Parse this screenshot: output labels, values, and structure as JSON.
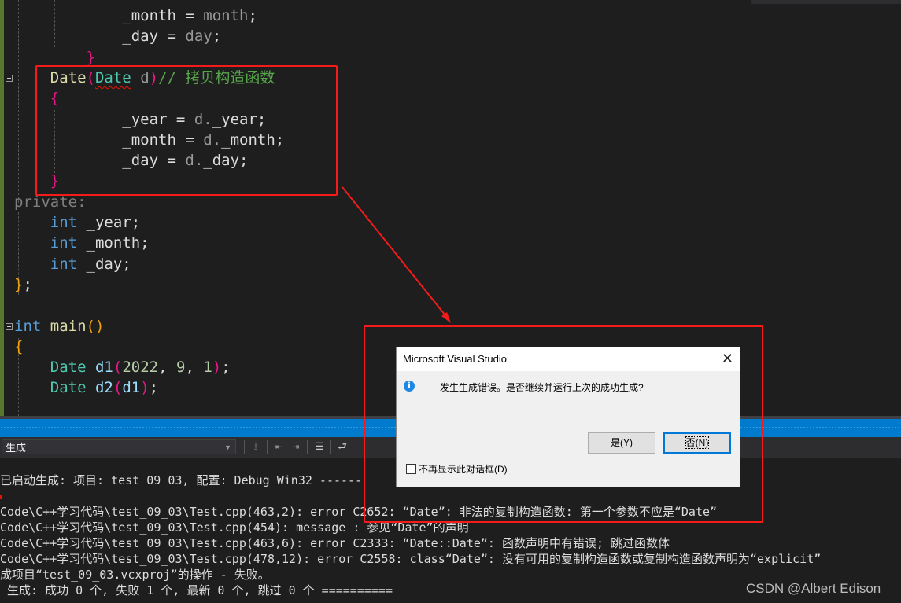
{
  "colors": {
    "accent": "#007acc",
    "annotation": "#f51b1b",
    "error_squiggle": "#e51400"
  },
  "editor": {
    "lines": [
      [
        [
          "            ",
          ""
        ],
        [
          "_month",
          "id"
        ],
        [
          " = ",
          "id"
        ],
        [
          "month",
          "pr"
        ],
        [
          ";",
          "id"
        ]
      ],
      [
        [
          "            ",
          ""
        ],
        [
          "_day",
          "id"
        ],
        [
          " = ",
          "id"
        ],
        [
          "day",
          "pr"
        ],
        [
          ";",
          "id"
        ]
      ],
      [
        [
          "        ",
          ""
        ],
        [
          "}",
          "br1"
        ]
      ],
      [
        [
          "    ",
          ""
        ],
        [
          "Date",
          "fn"
        ],
        [
          "(",
          "br1"
        ],
        [
          "Date",
          "ty sq"
        ],
        [
          " ",
          ""
        ],
        [
          "d",
          "pr"
        ],
        [
          ")",
          "br1"
        ],
        [
          "// 拷贝构造函数",
          "cm"
        ]
      ],
      [
        [
          "    ",
          ""
        ],
        [
          "{",
          "br1"
        ]
      ],
      [
        [
          "            ",
          ""
        ],
        [
          "_year",
          "id"
        ],
        [
          " = ",
          "id"
        ],
        [
          "d.",
          "pr"
        ],
        [
          "_year",
          "id"
        ],
        [
          ";",
          "id"
        ]
      ],
      [
        [
          "            ",
          ""
        ],
        [
          "_month",
          "id"
        ],
        [
          " = ",
          "id"
        ],
        [
          "d.",
          "pr"
        ],
        [
          "_month",
          "id"
        ],
        [
          ";",
          "id"
        ]
      ],
      [
        [
          "            ",
          ""
        ],
        [
          "_day",
          "id"
        ],
        [
          " = ",
          "id"
        ],
        [
          "d.",
          "pr"
        ],
        [
          "_day",
          "id"
        ],
        [
          ";",
          "id"
        ]
      ],
      [
        [
          "    ",
          ""
        ],
        [
          "}",
          "br1"
        ]
      ],
      [
        [
          "private:",
          "pv"
        ]
      ],
      [
        [
          "    ",
          ""
        ],
        [
          "int",
          "kw"
        ],
        [
          " _year;",
          "id"
        ]
      ],
      [
        [
          "    ",
          ""
        ],
        [
          "int",
          "kw"
        ],
        [
          " _month;",
          "id"
        ]
      ],
      [
        [
          "    ",
          ""
        ],
        [
          "int",
          "kw"
        ],
        [
          " _day;",
          "id"
        ]
      ],
      [
        [
          "}",
          "br2"
        ],
        [
          ";",
          "id"
        ]
      ],
      [
        [
          "",
          ""
        ]
      ],
      [
        [
          "int",
          "kw"
        ],
        [
          " ",
          ""
        ],
        [
          "main",
          "fn"
        ],
        [
          "()",
          "br2"
        ]
      ],
      [
        [
          "{",
          "br2"
        ]
      ],
      [
        [
          "    ",
          ""
        ],
        [
          "Date",
          "ty"
        ],
        [
          " ",
          ""
        ],
        [
          "d1",
          "lv"
        ],
        [
          "(",
          "br1"
        ],
        [
          "2022",
          "nm"
        ],
        [
          ", ",
          ""
        ],
        [
          "9",
          "nm"
        ],
        [
          ", ",
          ""
        ],
        [
          "1",
          "nm"
        ],
        [
          ")",
          "br1"
        ],
        [
          ";",
          "id"
        ]
      ],
      [
        [
          "    ",
          ""
        ],
        [
          "Date",
          "ty"
        ],
        [
          " ",
          ""
        ],
        [
          "d2",
          "lv"
        ],
        [
          "(",
          "br1"
        ],
        [
          "d1",
          "lv"
        ],
        [
          ")",
          "br1"
        ],
        [
          ";",
          "id"
        ]
      ]
    ]
  },
  "output_panel": {
    "source_label": "生成",
    "lines": [
      "已启动生成: 项目: test_09_03, 配置: Debug Win32 ------",
      "",
      "Code\\C++学习代码\\test_09_03\\Test.cpp(463,2): error C2652: “Date”: 非法的复制构造函数: 第一个参数不应是“Date”",
      "Code\\C++学习代码\\test_09_03\\Test.cpp(454): message : 参见“Date”的声明",
      "Code\\C++学习代码\\test_09_03\\Test.cpp(463,6): error C2333: “Date::Date”: 函数声明中有错误; 跳过函数体",
      "Code\\C++学习代码\\test_09_03\\Test.cpp(478,12): error C2558: class“Date”: 没有可用的复制构造函数或复制构造函数声明为“explicit”",
      "成项目“test_09_03.vcxproj”的操作 - 失败。",
      " 生成: 成功 0 个, 失败 1 个, 最新 0 个, 跳过 0 个 =========="
    ]
  },
  "dialog": {
    "title": "Microsoft Visual Studio",
    "message": "发生生成错误。是否继续并运行上次的成功生成?",
    "yes_label": "是(Y)",
    "no_label": "否(N)",
    "checkbox_label": "不再显示此对话框(D)",
    "checkbox_checked": false
  },
  "watermark": "CSDN @Albert Edison"
}
